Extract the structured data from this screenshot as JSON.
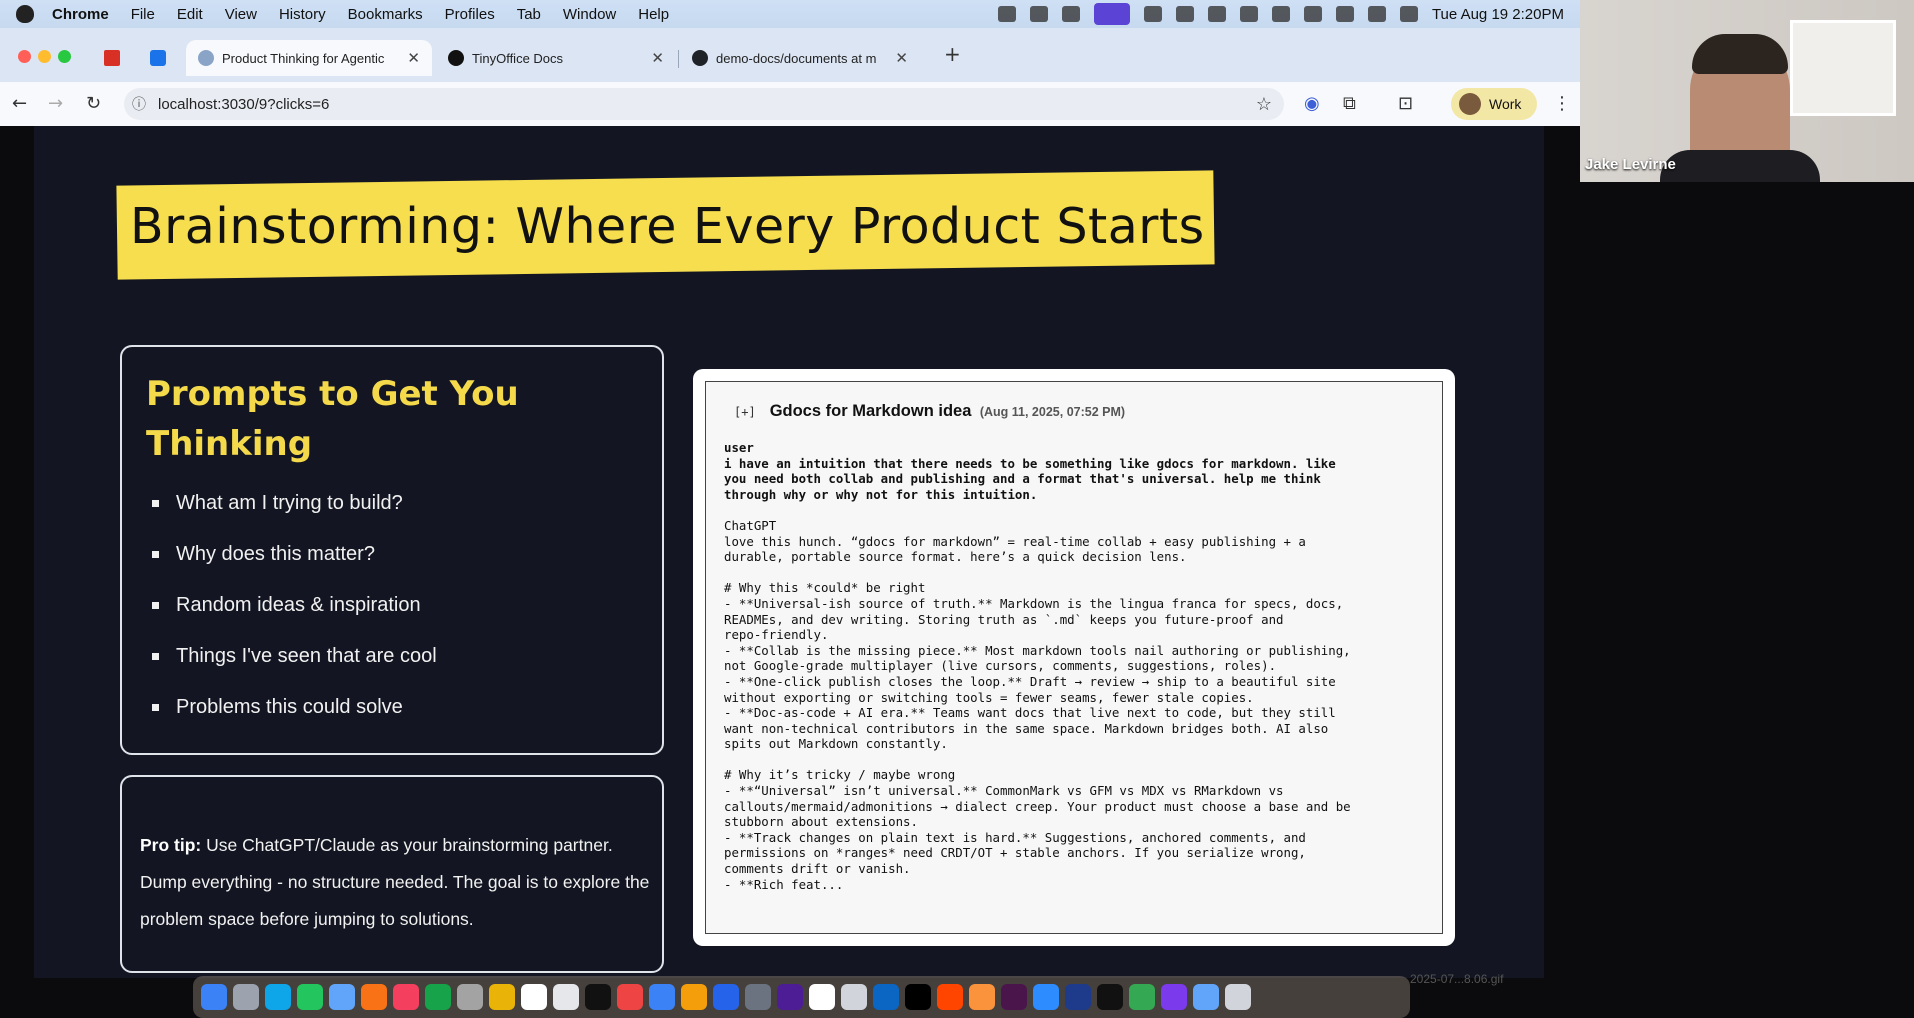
{
  "menubar": {
    "app": "Chrome",
    "items": [
      "File",
      "Edit",
      "View",
      "History",
      "Bookmarks",
      "Profiles",
      "Tab",
      "Window",
      "Help"
    ],
    "clock": "Tue Aug 19  2:20PM"
  },
  "browser": {
    "tabs": [
      {
        "title": "",
        "icon": "gmail-icon"
      },
      {
        "title": "",
        "icon": "calendar-icon"
      },
      {
        "title": "Product Thinking for Agentic",
        "icon": "globe-icon",
        "active": true
      },
      {
        "title": "TinyOffice Docs",
        "icon": "tinyoffice-icon"
      },
      {
        "title": "demo-docs/documents at m",
        "icon": "github-icon"
      }
    ],
    "url": "localhost:3030/9?clicks=6",
    "profile": "Work"
  },
  "slide": {
    "title": "Brainstorming: Where Every Product Starts",
    "prompts_heading": "Prompts to Get You Thinking",
    "prompts": [
      "What am I trying to build?",
      "Why does this matter?",
      "Random ideas & inspiration",
      "Things I've seen that are cool",
      "Problems this could solve"
    ],
    "tip_label": "Pro tip:",
    "tip_text": " Use ChatGPT/Claude as your brainstorming partner. Dump everything - no structure needed. The goal is to explore the problem space before jumping to solutions."
  },
  "chat": {
    "expander": "[+]",
    "title": "Gdocs for Markdown idea",
    "timestamp": "(Aug 11, 2025, 07:52 PM)",
    "user_label": "user",
    "user_message": "i have an intuition that there needs to be something like gdocs for markdown. like\nyou need both collab and publishing and a format that's universal. help me think\nthrough why or why not for this intuition.",
    "assistant_label": "ChatGPT",
    "assistant_message": "love this hunch. “gdocs for markdown” = real-time collab + easy publishing + a\ndurable, portable source format. here’s a quick decision lens.\n\n# Why this *could* be right\n- **Universal-ish source of truth.** Markdown is the lingua franca for specs, docs,\nREADMEs, and dev writing. Storing truth as `.md` keeps you future-proof and\nrepo-friendly.\n- **Collab is the missing piece.** Most markdown tools nail authoring or publishing,\nnot Google-grade multiplayer (live cursors, comments, suggestions, roles).\n- **One-click publish closes the loop.** Draft → review → ship to a beautiful site\nwithout exporting or switching tools = fewer seams, fewer stale copies.\n- **Doc-as-code + AI era.** Teams want docs that live next to code, but they still\nwant non-technical contributors in the same space. Markdown bridges both. AI also\nspits out Markdown constantly.\n\n# Why it’s tricky / maybe wrong\n- **“Universal” isn’t universal.** CommonMark vs GFM vs MDX vs RMarkdown vs\ncallouts/mermaid/admonitions → dialect creep. Your product must choose a base and be\nstubborn about extensions.\n- **Track changes on plain text is hard.** Suggestions, anchored comments, and\npermissions on *ranges* need CRDT/OT + stable anchors. If you serialize wrong,\ncomments drift or vanish.\n- **Rich feat..."
  },
  "webcam": {
    "name": "Jake Levirne"
  },
  "dock": {
    "corner_text": "2025-07...8.06.gif"
  }
}
